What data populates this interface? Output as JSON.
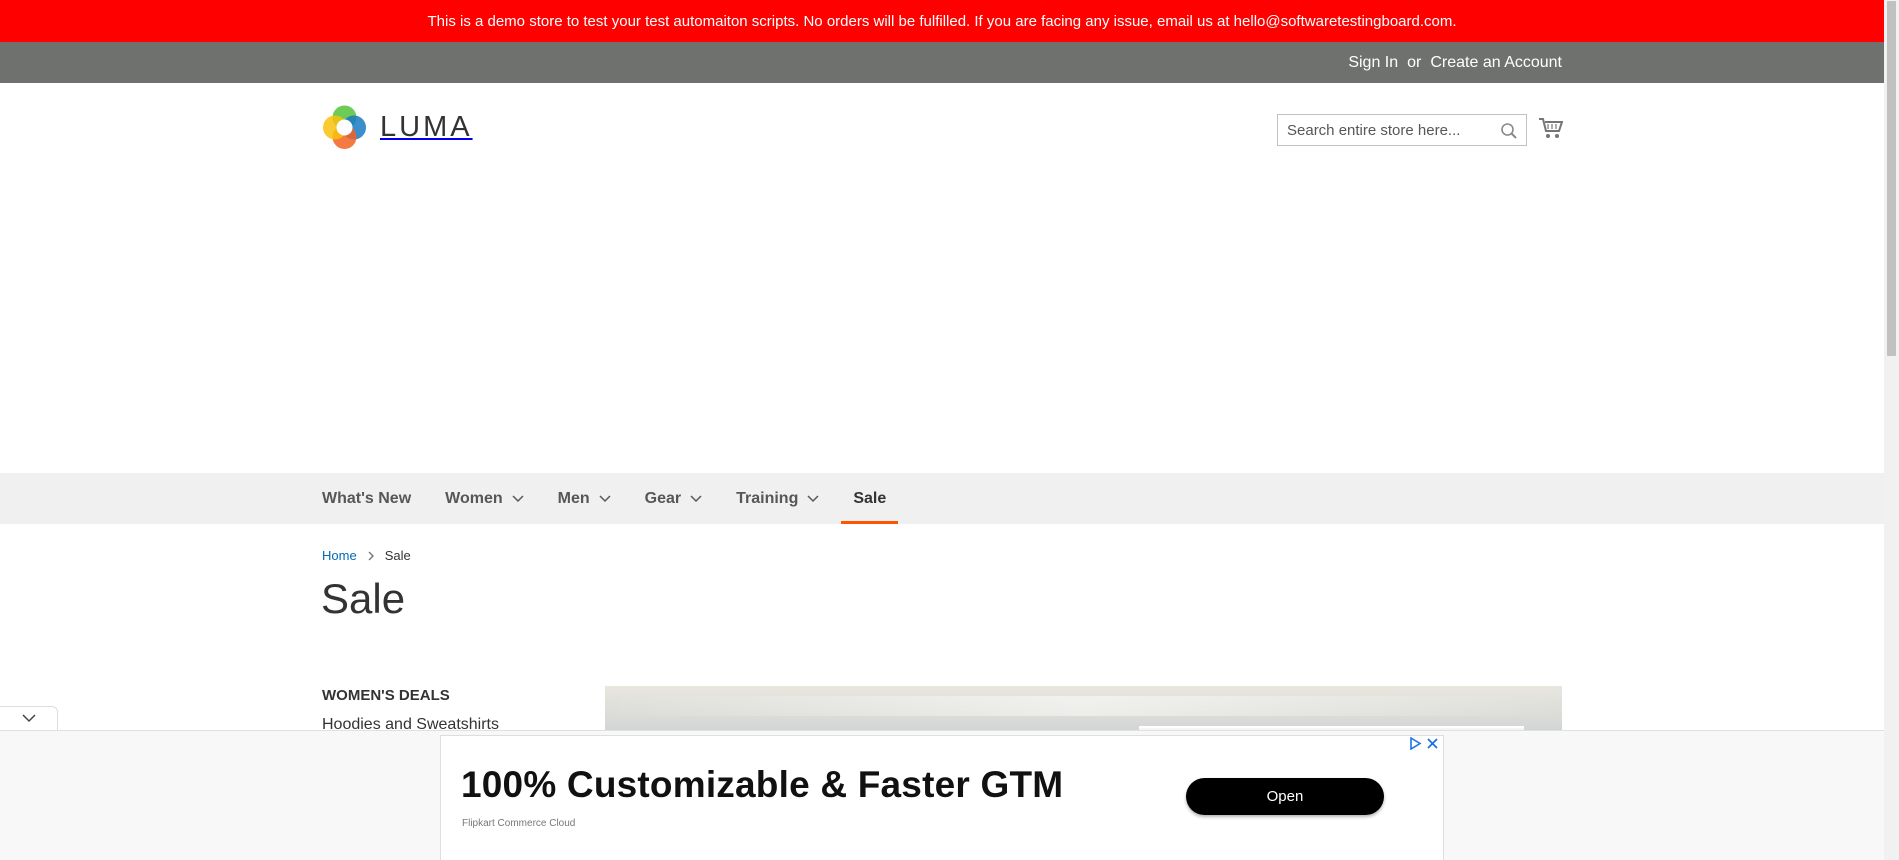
{
  "demo_notice": "This is a demo store to test your test automaiton scripts. No orders will be fulfilled. If you are facing any issue, email us at hello@softwaretestingboard.com.",
  "header_links": {
    "sign_in": "Sign In",
    "separator": "or",
    "create_account": "Create an Account"
  },
  "logo": {
    "text": "LUMA",
    "icon": "luma-logo-icon"
  },
  "search": {
    "placeholder": "Search entire store here...",
    "value": "",
    "icon": "search-icon"
  },
  "cart": {
    "icon": "cart-icon"
  },
  "nav": {
    "items": [
      {
        "label": "What's New",
        "has_dropdown": false
      },
      {
        "label": "Women",
        "has_dropdown": true
      },
      {
        "label": "Men",
        "has_dropdown": true
      },
      {
        "label": "Gear",
        "has_dropdown": true
      },
      {
        "label": "Training",
        "has_dropdown": true
      },
      {
        "label": "Sale",
        "has_dropdown": false,
        "active": true
      }
    ]
  },
  "breadcrumb": {
    "home": "Home",
    "current": "Sale"
  },
  "page_title": "Sale",
  "sidebar": {
    "title": "WOMEN'S DEALS",
    "items": [
      "Hoodies and Sweatshirts"
    ]
  },
  "ad": {
    "headline": "100% Customizable & Faster GTM",
    "advertiser": "Flipkart Commerce Cloud",
    "cta": "Open"
  },
  "colors": {
    "banner": "#ff0000",
    "top_bar": "#6e716e",
    "nav_bg": "#f0f0f0",
    "active_accent": "#ff5501",
    "link": "#006bb4",
    "ad_icon": "#1a73e8"
  }
}
